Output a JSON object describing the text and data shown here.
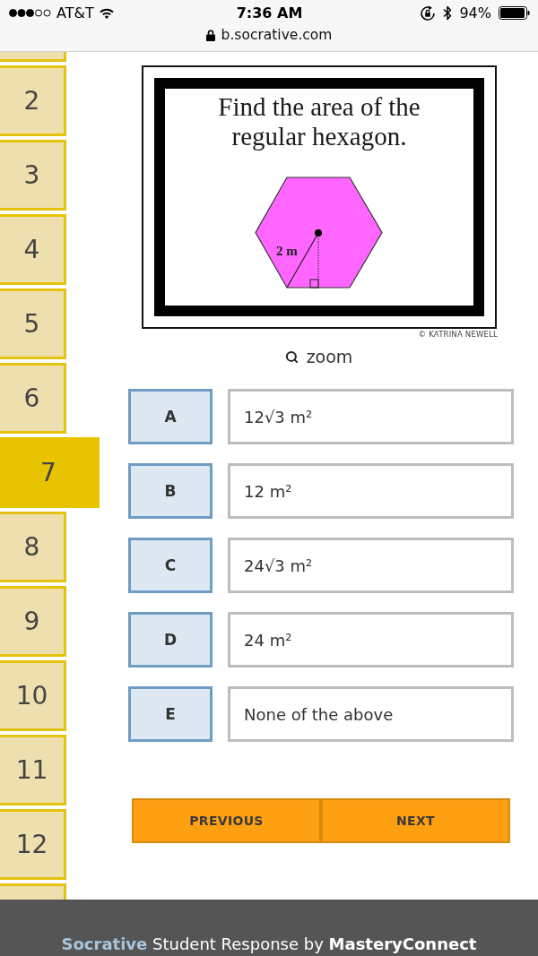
{
  "status_bar": {
    "carrier": "AT&T",
    "time": "7:36 AM",
    "battery": "94%",
    "url": "b.socrative.com"
  },
  "questions": [
    {
      "label": "2",
      "selected": false
    },
    {
      "label": "3",
      "selected": false
    },
    {
      "label": "4",
      "selected": false
    },
    {
      "label": "5",
      "selected": false
    },
    {
      "label": "6",
      "selected": false
    },
    {
      "label": "7",
      "selected": true
    },
    {
      "label": "8",
      "selected": false
    },
    {
      "label": "9",
      "selected": false
    },
    {
      "label": "10",
      "selected": false
    },
    {
      "label": "11",
      "selected": false
    },
    {
      "label": "12",
      "selected": false
    }
  ],
  "question_image": {
    "title": "Find the area of the regular hexagon.",
    "radius_label": "2 m",
    "credit": "© KATRINA NEWELL"
  },
  "zoom": {
    "label": "zoom"
  },
  "answers": [
    {
      "letter": "A",
      "text": "12√3 m²",
      "selected": false
    },
    {
      "letter": "B",
      "text": "12 m²",
      "selected": false
    },
    {
      "letter": "C",
      "text": "24√3 m²",
      "selected": false
    },
    {
      "letter": "D",
      "text": "24 m²",
      "selected": false
    },
    {
      "letter": "E",
      "text": "None of the above",
      "selected": false
    }
  ],
  "navigation": [
    {
      "label": "PREVIOUS"
    },
    {
      "label": "NEXT"
    }
  ],
  "footer": {
    "brand": "Socrative",
    "tagline": "Student Response by",
    "company": "MasteryConnect"
  }
}
